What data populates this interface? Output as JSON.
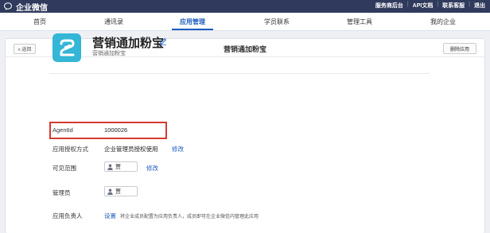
{
  "topbar": {
    "brand": "企业微信",
    "links": [
      "服务商后台",
      "API文档",
      "联系客服",
      "退出"
    ]
  },
  "nav": {
    "items": [
      "首页",
      "通讯录",
      "应用管理",
      "学员联系",
      "管理工具",
      "我的企业"
    ],
    "active_index": 2
  },
  "header": {
    "back_label": "« 返回",
    "title": "营销通加粉宝",
    "delete_label": "删除应用"
  },
  "app": {
    "name": "营销通加粉宝",
    "subtitle": "营销通加粉宝",
    "icon_color": "#34b6d6"
  },
  "fields": {
    "agentid": {
      "label": "AgentId",
      "value": "1000026"
    },
    "auth": {
      "label": "应用授权方式",
      "value": "企业管理员授权使用",
      "action": "修改"
    },
    "visible": {
      "label": "可见范围",
      "tag": "贾",
      "action": "修改"
    },
    "admin": {
      "label": "管理员",
      "tag": "贾"
    },
    "owner": {
      "label": "应用负责人",
      "action": "设置",
      "hint": "将企业成员配置为应用负责人，成员即可在企业微信内管理此应用"
    }
  },
  "colors": {
    "topbar": "#2f3a5c",
    "accent": "#1d5bbf",
    "highlight": "#d43a2f"
  }
}
